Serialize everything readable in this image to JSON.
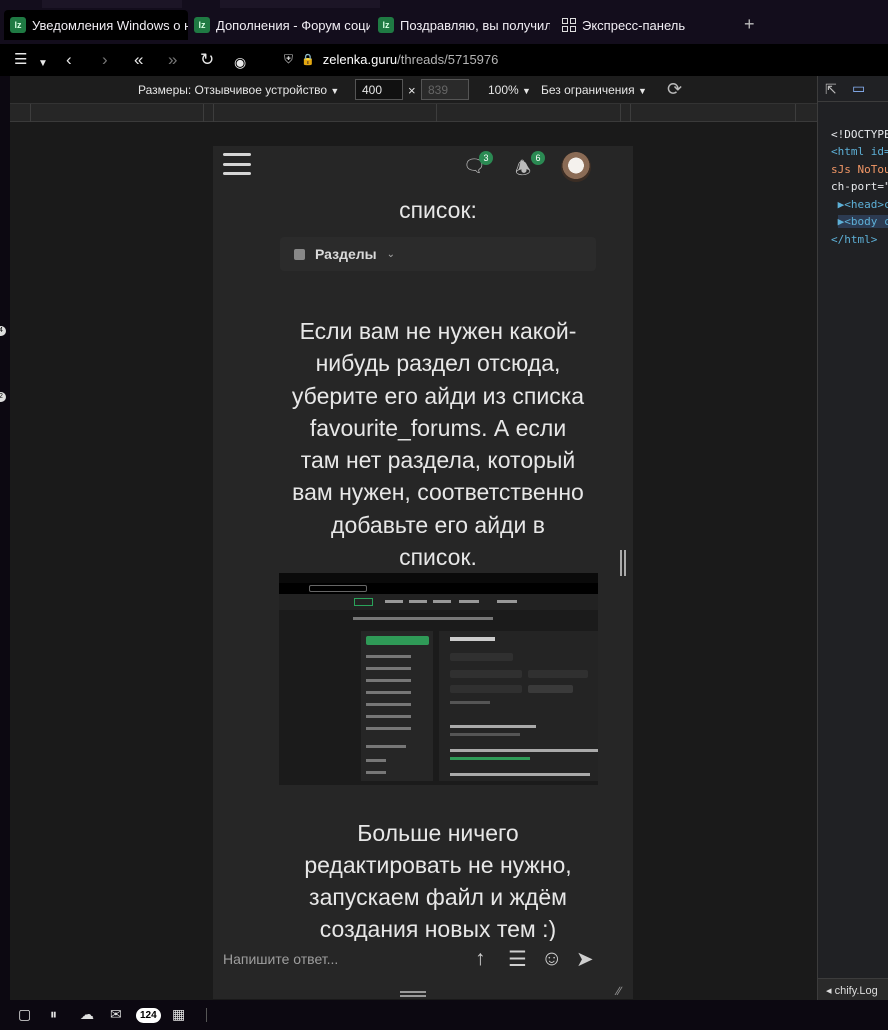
{
  "tabs": [
    {
      "label": "Уведомления Windows о н",
      "icon": "lolzteam-favicon"
    },
    {
      "label": "Дополнения - Форум соци",
      "icon": "lolzteam-favicon"
    },
    {
      "label": "Поздравляю, вы получили",
      "icon": "lolzteam-favicon"
    },
    {
      "label": "Экспресс-панель",
      "icon": "grid-icon"
    }
  ],
  "new_tab": "+",
  "address": {
    "host": "zelenka.guru",
    "path": "/threads/5715976"
  },
  "responsive_bar": {
    "device_label": "Размеры: Отзывчивое устройство",
    "width": "400",
    "times": "×",
    "height_placeholder": "839",
    "zoom": "100%",
    "throttle": "Без ограничения"
  },
  "site": {
    "messages_badge": "3",
    "alerts_badge": "6",
    "text_top": "список:",
    "sections_button": "Разделы",
    "paragraph_1": [
      "Если вам не нужен какой-",
      "нибудь раздел отсюда,",
      "уберите его айди из списка",
      "favourite_forums. А если",
      "там нет раздела, который",
      "вам нужен, соответственно",
      "добавьте его айди в",
      "список."
    ],
    "paragraph_2": [
      "Больше ничего",
      "редактировать не нужно,",
      "запускаем файл и ждём",
      "создания новых тем :)"
    ],
    "reply_placeholder": "Напишите ответ..."
  },
  "devtools": {
    "lines": [
      "<!DOCTYPE",
      "<html id=",
      "sJs NoTou",
      "ch-port=\"",
      "▶<head>c",
      "▶<body c",
      "</html>"
    ],
    "console_label": "◂  chify.Log"
  },
  "taskbar": {
    "mail_count": "124"
  },
  "colors": {
    "accent_green": "#2b8a53",
    "page_bg": "#262626",
    "browser_bg": "#000000"
  }
}
